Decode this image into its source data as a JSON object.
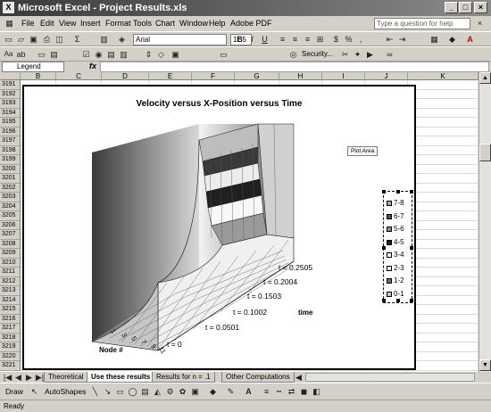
{
  "window": {
    "title": "Microsoft Excel - Project Results.xls",
    "app_icon": "excel-icon",
    "minimize": "_",
    "restore": "□",
    "close": "×"
  },
  "menu": {
    "items": [
      "File",
      "Edit",
      "View",
      "Insert",
      "Format",
      "Tools",
      "Chart",
      "Window",
      "Help",
      "Adobe PDF"
    ],
    "help_placeholder": "Type a question for help"
  },
  "toolbar": {
    "font_name": "Arial",
    "font_size": "11.5",
    "bold": "B",
    "italic": "I",
    "underline": "U",
    "security": "Security..."
  },
  "formula_bar": {
    "name_box": "Legend",
    "fx": "fx"
  },
  "columns": [
    "B",
    "C",
    "D",
    "E",
    "F",
    "G",
    "H",
    "I",
    "J",
    "K"
  ],
  "rows": [
    "3191",
    "3192",
    "3193",
    "3194",
    "3195",
    "3196",
    "3197",
    "3198",
    "3199",
    "3200",
    "3201",
    "3202",
    "3203",
    "3204",
    "3205",
    "3206",
    "3207",
    "3208",
    "3209",
    "3210",
    "3211",
    "3212",
    "3213",
    "3214",
    "3215",
    "3216",
    "3217",
    "3218",
    "3219",
    "3220",
    "3221"
  ],
  "chart": {
    "title": "Velocity versus X-Position versus Time",
    "x_axis_title": "Node #",
    "x_ticks": [
      "1",
      "3",
      "5",
      "7",
      "9",
      "11"
    ],
    "y_axis_title": "time",
    "y_ticks": [
      "t = 0",
      "t = 0.0501",
      "t = 0.1002",
      "t = 0.1503",
      "t = 0.2004",
      "t = 0.2505"
    ],
    "plot_area_label": "Plot Area",
    "legend": [
      {
        "label": "7-8",
        "color": "#a8a8a8"
      },
      {
        "label": "6-7",
        "color": "#505050"
      },
      {
        "label": "5-6",
        "color": "#8c8c8c"
      },
      {
        "label": "4-5",
        "color": "#1e1e1e"
      },
      {
        "label": "3-4",
        "color": "#ffffff"
      },
      {
        "label": "2-3",
        "color": "#ececec"
      },
      {
        "label": "1-2",
        "color": "#6e6e6e"
      },
      {
        "label": "0-1",
        "color": "#c8c8c8"
      }
    ]
  },
  "sheet_tabs": [
    "Theoretical",
    "Use these results",
    "Results for n = .1",
    "Other Computations"
  ],
  "draw_toolbar": {
    "draw": "Draw",
    "autoshapes": "AutoShapes"
  },
  "status": "Ready"
}
